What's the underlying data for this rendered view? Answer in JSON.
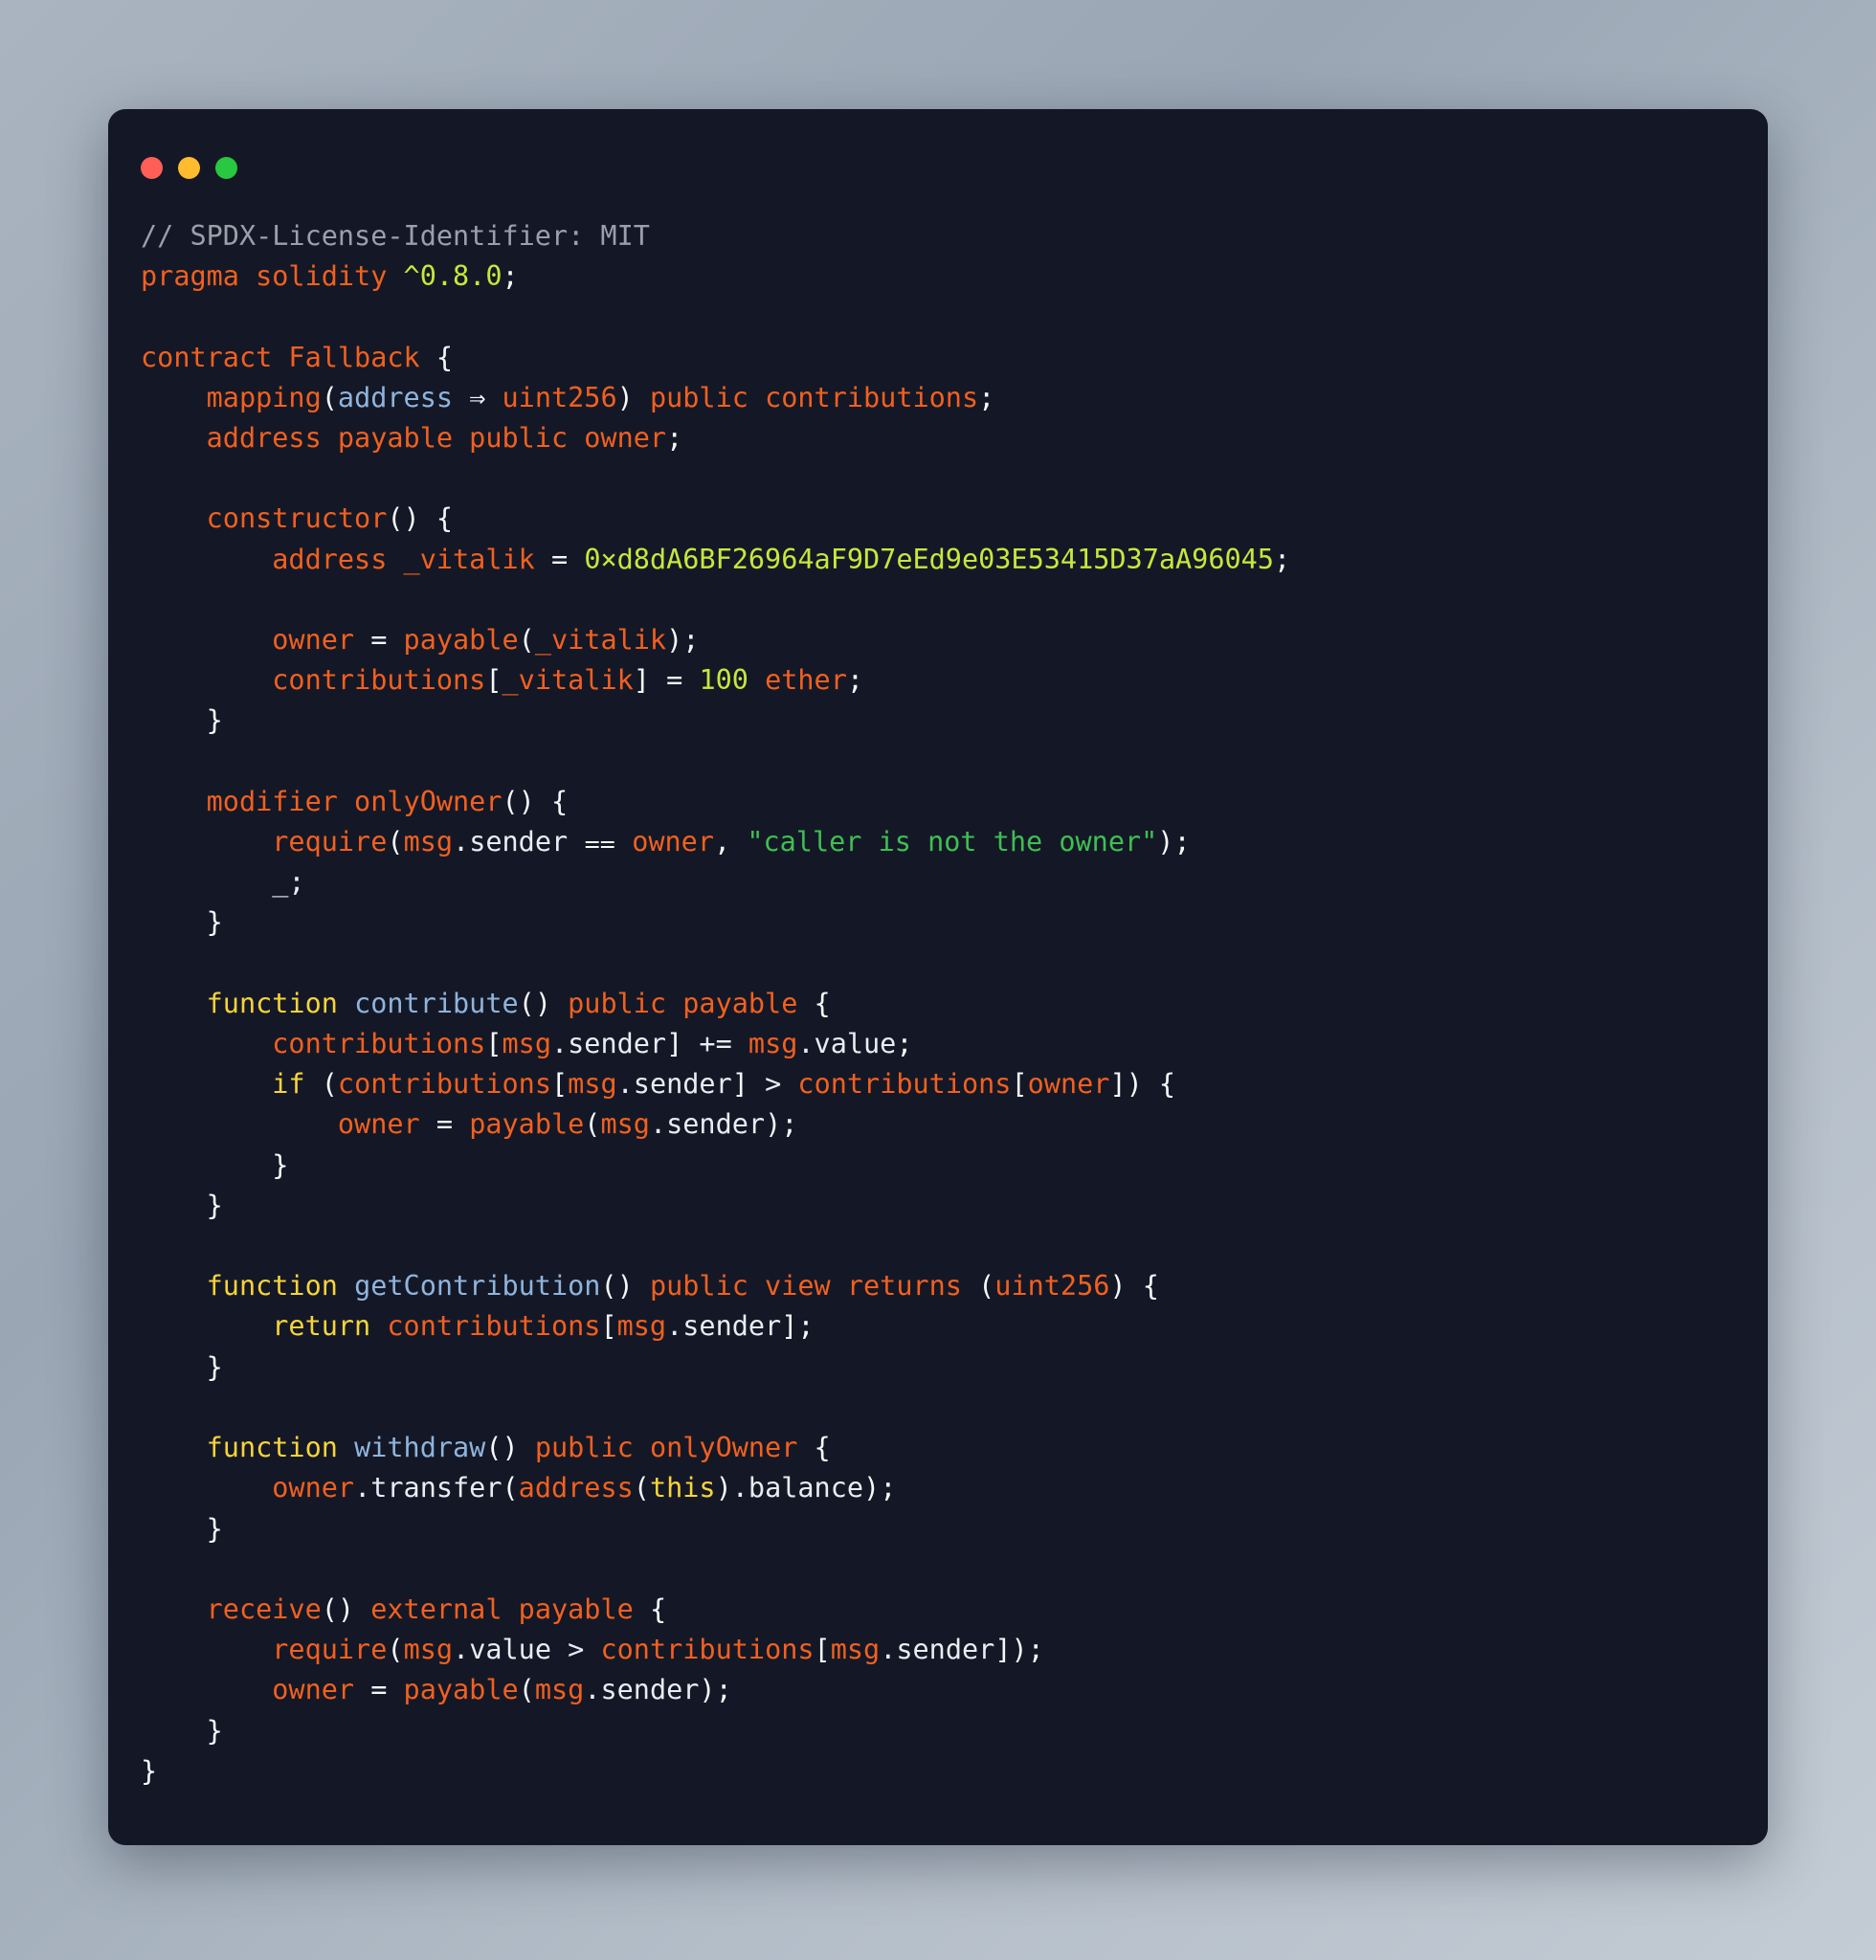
{
  "window": {
    "traffic_lights": [
      {
        "name": "close",
        "color": "#ff5f57"
      },
      {
        "name": "minimize",
        "color": "#febc2e"
      },
      {
        "name": "maximize",
        "color": "#28c840"
      }
    ],
    "background": "#141826"
  },
  "theme": {
    "comment": "#9aa0ab",
    "keyword": "#f2601f",
    "control_keyword": "#f7d43a",
    "function_name": "#8fb4dd",
    "type": "#8fb4dd",
    "number": "#c9e63c",
    "string": "#3fbf52",
    "punctuation": "#f5f7fa",
    "plain": "#e9ecf2"
  },
  "code": {
    "language": "solidity",
    "contract_name": "Fallback",
    "license": "MIT",
    "pragma_version": "^0.8.0",
    "vitalik_address": "0xd8dA6BF26964aF9D7eEd9e03E53415D37aA96045",
    "initial_contribution": "100 ether",
    "require_message": "caller is not the owner",
    "lines": [
      "// SPDX-License-Identifier: MIT",
      "pragma solidity ^0.8.0;",
      "",
      "contract Fallback {",
      "    mapping(address => uint256) public contributions;",
      "    address payable public owner;",
      "",
      "    constructor() {",
      "        address _vitalik = 0xd8dA6BF26964aF9D7eEd9e03E53415D37aA96045;",
      "",
      "        owner = payable(_vitalik);",
      "        contributions[_vitalik] = 100 ether;",
      "    }",
      "",
      "    modifier onlyOwner() {",
      "        require(msg.sender == owner, \"caller is not the owner\");",
      "        _;",
      "    }",
      "",
      "    function contribute() public payable {",
      "        contributions[msg.sender] += msg.value;",
      "        if (contributions[msg.sender] > contributions[owner]) {",
      "            owner = payable(msg.sender);",
      "        }",
      "    }",
      "",
      "    function getContribution() public view returns (uint256) {",
      "        return contributions[msg.sender];",
      "    }",
      "",
      "    function withdraw() public onlyOwner {",
      "        owner.transfer(address(this).balance);",
      "    }",
      "",
      "    receive() external payable {",
      "        require(msg.value > contributions[msg.sender]);",
      "        owner = payable(msg.sender);",
      "    }",
      "}"
    ],
    "tokens": [
      [
        [
          "// SPDX-License-Identifier: MIT",
          "com"
        ]
      ],
      [
        [
          "pragma solidity ",
          "kw"
        ],
        [
          "^0.8.0",
          "num"
        ],
        [
          ";",
          "pun"
        ]
      ],
      [],
      [
        [
          "contract Fallback ",
          "kw"
        ],
        [
          "{",
          "pun"
        ]
      ],
      [
        [
          "    mapping",
          "kw"
        ],
        [
          "(",
          "pun"
        ],
        [
          "address",
          "type"
        ],
        [
          " ⇒ ",
          "pun"
        ],
        [
          "uint256",
          "kw"
        ],
        [
          ")",
          "pun"
        ],
        [
          " public contributions",
          "kw"
        ],
        [
          ";",
          "pun"
        ]
      ],
      [
        [
          "    address payable public owner",
          "kw"
        ],
        [
          ";",
          "pun"
        ]
      ],
      [],
      [
        [
          "    constructor",
          "kw"
        ],
        [
          "() {",
          "pun"
        ]
      ],
      [
        [
          "        address ",
          "kw"
        ],
        [
          "_vitalik",
          "var"
        ],
        [
          " = ",
          "pun"
        ],
        [
          "0×d8dA6BF26964aF9D7eEd9e03E53415D37aA96045",
          "num"
        ],
        [
          ";",
          "pun"
        ]
      ],
      [],
      [
        [
          "        owner",
          "kw"
        ],
        [
          " = ",
          "pun"
        ],
        [
          "payable",
          "kw"
        ],
        [
          "(",
          "pun"
        ],
        [
          "_vitalik",
          "kw"
        ],
        [
          ")",
          "pun"
        ],
        [
          ";",
          "pun"
        ]
      ],
      [
        [
          "        contributions",
          "kw"
        ],
        [
          "[",
          "pun"
        ],
        [
          "_vitalik",
          "kw"
        ],
        [
          "]",
          "pun"
        ],
        [
          " = ",
          "pun"
        ],
        [
          "100",
          "num"
        ],
        [
          " ether",
          "kw"
        ],
        [
          ";",
          "pun"
        ]
      ],
      [
        [
          "    }",
          "pun"
        ]
      ],
      [],
      [
        [
          "    modifier onlyOwner",
          "kw"
        ],
        [
          "() {",
          "pun"
        ]
      ],
      [
        [
          "        require",
          "kw"
        ],
        [
          "(",
          "pun"
        ],
        [
          "msg",
          "kw"
        ],
        [
          ".sender",
          "plain"
        ],
        [
          " ⩵ ",
          "pun"
        ],
        [
          "owner",
          "kw"
        ],
        [
          ", ",
          "pun"
        ],
        [
          "\"caller is not the owner\"",
          "str"
        ],
        [
          ")",
          "pun"
        ],
        [
          ";",
          "pun"
        ]
      ],
      [
        [
          "        _;",
          "plain"
        ]
      ],
      [
        [
          "    }",
          "pun"
        ]
      ],
      [],
      [
        [
          "    function",
          "kw2"
        ],
        [
          " contribute",
          "fn"
        ],
        [
          "()",
          "pun"
        ],
        [
          " public payable ",
          "kw"
        ],
        [
          "{",
          "pun"
        ]
      ],
      [
        [
          "        contributions",
          "kw"
        ],
        [
          "[",
          "pun"
        ],
        [
          "msg",
          "kw"
        ],
        [
          ".sender",
          "plain"
        ],
        [
          "]",
          "pun"
        ],
        [
          " += ",
          "plain"
        ],
        [
          "msg",
          "kw"
        ],
        [
          ".value",
          "plain"
        ],
        [
          ";",
          "pun"
        ]
      ],
      [
        [
          "        if",
          "kw2"
        ],
        [
          " (",
          "pun"
        ],
        [
          "contributions",
          "kw"
        ],
        [
          "[",
          "pun"
        ],
        [
          "msg",
          "kw"
        ],
        [
          ".sender",
          "plain"
        ],
        [
          "]",
          "pun"
        ],
        [
          " > ",
          "plain"
        ],
        [
          "contributions",
          "kw"
        ],
        [
          "[",
          "pun"
        ],
        [
          "owner",
          "kw"
        ],
        [
          "])",
          "pun"
        ],
        [
          " {",
          "pun"
        ]
      ],
      [
        [
          "            owner",
          "kw"
        ],
        [
          " = ",
          "pun"
        ],
        [
          "payable",
          "kw"
        ],
        [
          "(",
          "pun"
        ],
        [
          "msg",
          "kw"
        ],
        [
          ".sender",
          "plain"
        ],
        [
          ")",
          "pun"
        ],
        [
          ";",
          "pun"
        ]
      ],
      [
        [
          "        }",
          "pun"
        ]
      ],
      [
        [
          "    }",
          "pun"
        ]
      ],
      [],
      [
        [
          "    function",
          "kw2"
        ],
        [
          " getContribution",
          "fn"
        ],
        [
          "()",
          "pun"
        ],
        [
          " public view returns ",
          "kw"
        ],
        [
          "(",
          "pun"
        ],
        [
          "uint256",
          "kw"
        ],
        [
          ")",
          "pun"
        ],
        [
          " {",
          "pun"
        ]
      ],
      [
        [
          "        return",
          "kw2"
        ],
        [
          " contributions",
          "kw"
        ],
        [
          "[",
          "pun"
        ],
        [
          "msg",
          "kw"
        ],
        [
          ".sender",
          "plain"
        ],
        [
          "]",
          "pun"
        ],
        [
          ";",
          "pun"
        ]
      ],
      [
        [
          "    }",
          "pun"
        ]
      ],
      [],
      [
        [
          "    function",
          "kw2"
        ],
        [
          " withdraw",
          "fn"
        ],
        [
          "()",
          "pun"
        ],
        [
          " public onlyOwner ",
          "kw"
        ],
        [
          "{",
          "pun"
        ]
      ],
      [
        [
          "        owner",
          "kw"
        ],
        [
          ".transfer",
          "plain"
        ],
        [
          "(",
          "pun"
        ],
        [
          "address",
          "kw"
        ],
        [
          "(",
          "pun"
        ],
        [
          "this",
          "kw2"
        ],
        [
          ")",
          "pun"
        ],
        [
          ".balance",
          "plain"
        ],
        [
          ")",
          "pun"
        ],
        [
          ";",
          "pun"
        ]
      ],
      [
        [
          "    }",
          "pun"
        ]
      ],
      [],
      [
        [
          "    receive",
          "kw"
        ],
        [
          "() ",
          "pun"
        ],
        [
          "external payable ",
          "kw"
        ],
        [
          "{",
          "pun"
        ]
      ],
      [
        [
          "        require",
          "kw"
        ],
        [
          "(",
          "pun"
        ],
        [
          "msg",
          "kw"
        ],
        [
          ".value",
          "plain"
        ],
        [
          " > ",
          "plain"
        ],
        [
          "contributions",
          "kw"
        ],
        [
          "[",
          "pun"
        ],
        [
          "msg",
          "kw"
        ],
        [
          ".sender",
          "plain"
        ],
        [
          "])",
          "pun"
        ],
        [
          ";",
          "pun"
        ]
      ],
      [
        [
          "        owner",
          "kw"
        ],
        [
          " = ",
          "pun"
        ],
        [
          "payable",
          "kw"
        ],
        [
          "(",
          "pun"
        ],
        [
          "msg",
          "kw"
        ],
        [
          ".sender",
          "plain"
        ],
        [
          ")",
          "pun"
        ],
        [
          ";",
          "pun"
        ]
      ],
      [
        [
          "    }",
          "pun"
        ]
      ],
      [
        [
          "}",
          "pun"
        ]
      ]
    ]
  }
}
